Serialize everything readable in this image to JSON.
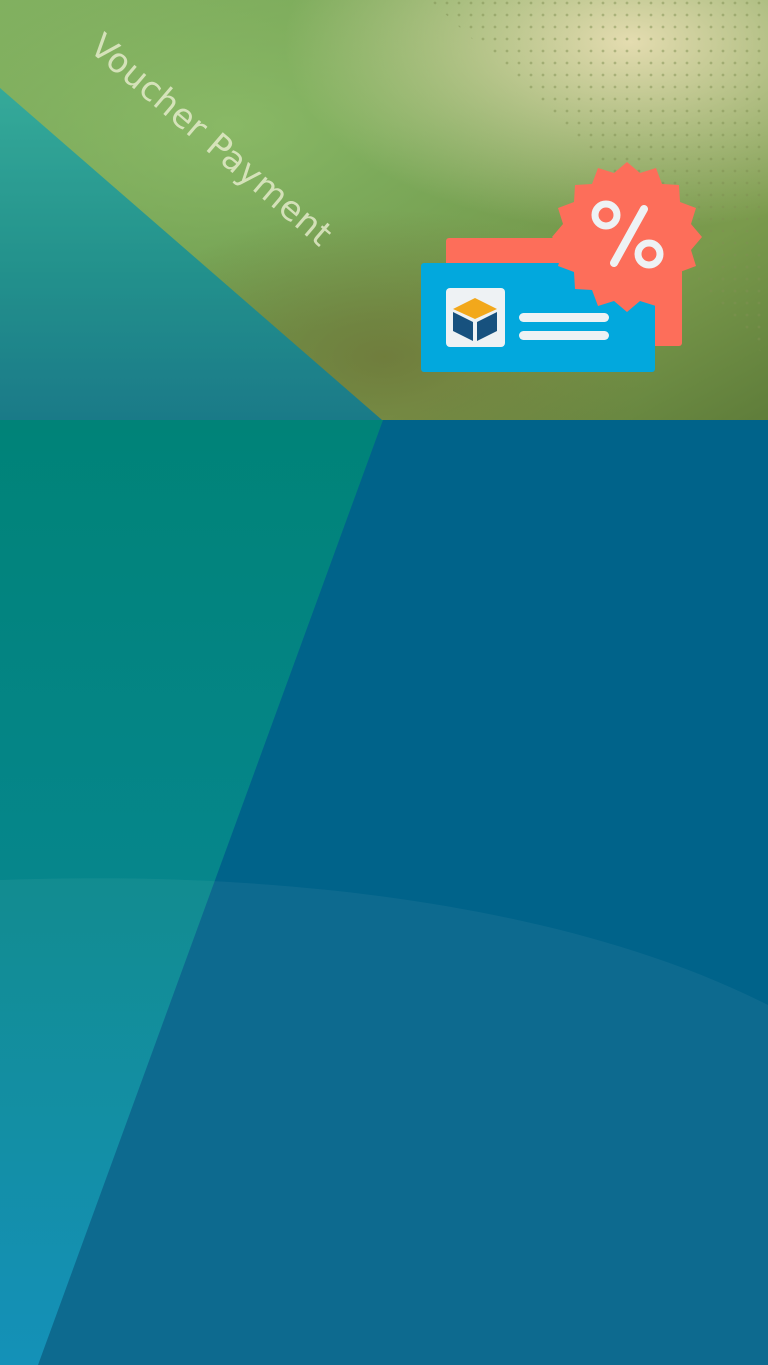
{
  "banner": {
    "title": "Voucher Payment"
  },
  "icons": {
    "voucher": "voucher-ticket-icon",
    "discount": "percent-badge-icon",
    "box": "box-logo-icon"
  },
  "colors": {
    "deep_blue": "#00648a",
    "teal": "#00877a",
    "ticket_blue": "#02a8dd",
    "badge_coral": "#fd6e5a",
    "box_orange": "#f2a81b",
    "box_navy": "#17517e"
  }
}
